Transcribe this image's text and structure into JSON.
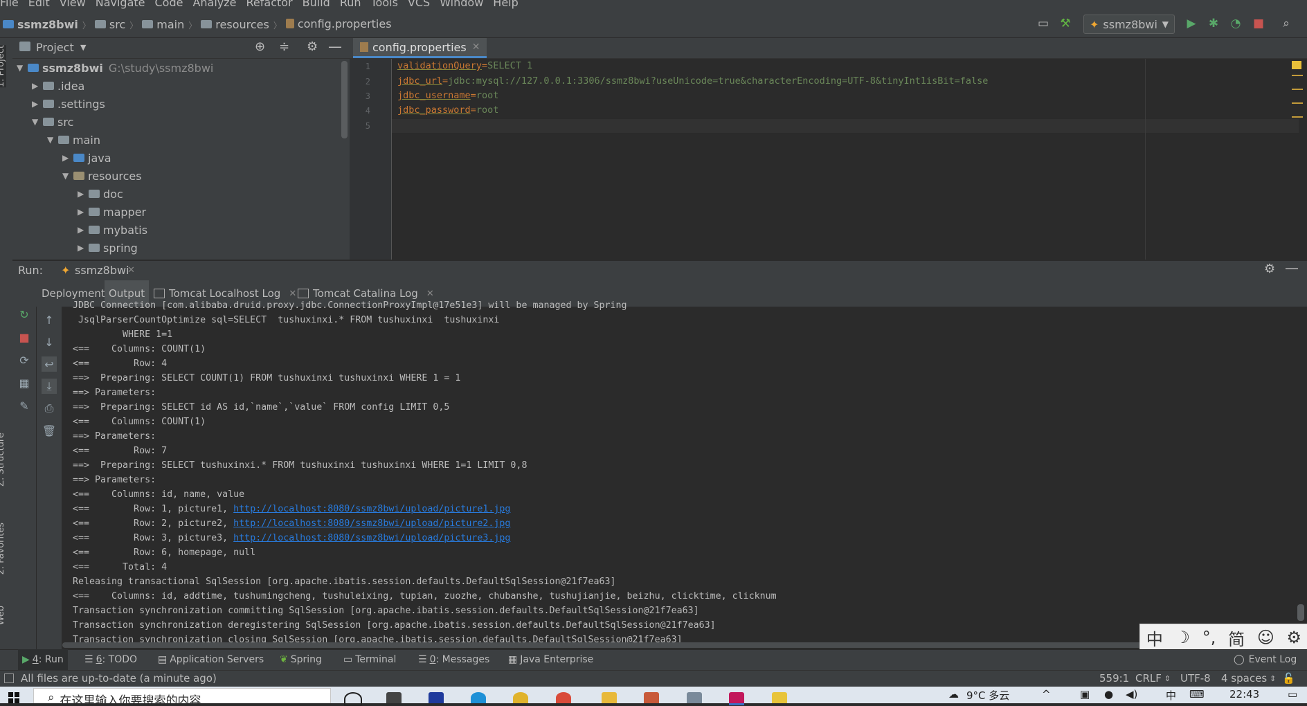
{
  "menu": [
    "File",
    "Edit",
    "View",
    "Navigate",
    "Code",
    "Analyze",
    "Refactor",
    "Build",
    "Run",
    "Tools",
    "VCS",
    "Window",
    "Help"
  ],
  "breadcrumbs": [
    "ssmz8bwi",
    "src",
    "main",
    "resources",
    "config.properties"
  ],
  "run_config": "ssmz8bwi",
  "side_labels": {
    "project": "1: Project",
    "structure": "Z: Structure",
    "favorites": "2: Favorites",
    "web": "Web"
  },
  "project_panel": {
    "title": "Project",
    "tree": [
      {
        "name": "ssmz8bwi",
        "path": "G:\\study\\ssmz8bwi",
        "depth": 0,
        "expanded": true
      },
      {
        "name": ".idea",
        "depth": 1,
        "expanded": false
      },
      {
        "name": ".settings",
        "depth": 1,
        "expanded": false
      },
      {
        "name": "src",
        "depth": 1,
        "expanded": true
      },
      {
        "name": "main",
        "depth": 2,
        "expanded": true
      },
      {
        "name": "java",
        "depth": 3,
        "expanded": false
      },
      {
        "name": "resources",
        "depth": 3,
        "expanded": true
      },
      {
        "name": "doc",
        "depth": 4,
        "expanded": false
      },
      {
        "name": "mapper",
        "depth": 4,
        "expanded": false
      },
      {
        "name": "mybatis",
        "depth": 4,
        "expanded": false
      },
      {
        "name": "spring",
        "depth": 4,
        "expanded": false
      }
    ]
  },
  "editor": {
    "tab": "config.properties",
    "lines": [
      {
        "num": "1",
        "key": "validationQuery",
        "value": "SELECT 1"
      },
      {
        "num": "2",
        "key": "jdbc_url",
        "value": "jdbc:mysql://127.0.0.1:3306/ssmz8bwi?useUnicode=true&characterEncoding=UTF-8&tinyInt1isBit=false"
      },
      {
        "num": "3",
        "key": "jdbc_username",
        "value": "root"
      },
      {
        "num": "4",
        "key": "jdbc_password",
        "value": "root"
      },
      {
        "num": "5",
        "key": "",
        "value": ""
      }
    ]
  },
  "run_panel": {
    "label": "Run:",
    "config": "ssmz8bwi",
    "tabs": [
      "Deployment",
      "Output",
      "Tomcat Localhost Log",
      "Tomcat Catalina Log"
    ],
    "console": [
      {
        "text": "JDBC Connection [com.alibaba.druid.proxy.jdbc.ConnectionProxyImpl@17e51e3] will be managed by Spring"
      },
      {
        "text": " JsqlParserCountOptimize sql=SELECT  tushuxinxi.* FROM tushuxinxi  tushuxinxi"
      },
      {
        "text": "         WHERE 1=1"
      },
      {
        "text": "<==    Columns: COUNT(1)"
      },
      {
        "text": "<==        Row: 4"
      },
      {
        "text": "==>  Preparing: SELECT COUNT(1) FROM tushuxinxi tushuxinxi WHERE 1 = 1"
      },
      {
        "text": "==> Parameters: "
      },
      {
        "text": "==>  Preparing: SELECT id AS id,`name`,`value` FROM config LIMIT 0,5"
      },
      {
        "text": "<==    Columns: COUNT(1)"
      },
      {
        "text": "==> Parameters: "
      },
      {
        "text": "<==        Row: 7"
      },
      {
        "text": "==>  Preparing: SELECT tushuxinxi.* FROM tushuxinxi tushuxinxi WHERE 1=1 LIMIT 0,8"
      },
      {
        "text": "==> Parameters: "
      },
      {
        "text": "<==    Columns: id, name, value"
      },
      {
        "text": "<==        Row: 1, picture1, ",
        "link": "http://localhost:8080/ssmz8bwi/upload/picture1.jpg"
      },
      {
        "text": "<==        Row: 2, picture2, ",
        "link": "http://localhost:8080/ssmz8bwi/upload/picture2.jpg"
      },
      {
        "text": "<==        Row: 3, picture3, ",
        "link": "http://localhost:8080/ssmz8bwi/upload/picture3.jpg"
      },
      {
        "text": "<==        Row: 6, homepage, null"
      },
      {
        "text": "<==      Total: 4"
      },
      {
        "text": "Releasing transactional SqlSession [org.apache.ibatis.session.defaults.DefaultSqlSession@21f7ea63]"
      },
      {
        "text": "<==    Columns: id, addtime, tushumingcheng, tushuleixing, tupian, zuozhe, chubanshe, tushujianjie, beizhu, clicktime, clicknum"
      },
      {
        "text": "Transaction synchronization committing SqlSession [org.apache.ibatis.session.defaults.DefaultSqlSession@21f7ea63]"
      },
      {
        "text": "Transaction synchronization deregistering SqlSession [org.apache.ibatis.session.defaults.DefaultSqlSession@21f7ea63]"
      },
      {
        "text": "Transaction synchronization closing SqlSession [org.apache.ibatis.session.defaults.DefaultSqlSession@21f7ea63]"
      }
    ]
  },
  "ime": [
    "中",
    "☽",
    "°,",
    "简",
    "☺",
    "⚙"
  ],
  "bottom_tabs": [
    {
      "num": "4",
      "label": ": Run"
    },
    {
      "num": "6",
      "label": ": TODO"
    },
    {
      "num": "",
      "label": "Application Servers"
    },
    {
      "num": "",
      "label": "Spring"
    },
    {
      "num": "",
      "label": "Terminal"
    },
    {
      "num": "0",
      "label": ": Messages"
    },
    {
      "num": "",
      "label": "Java Enterprise"
    }
  ],
  "event_log": "Event Log",
  "status": {
    "message": "All files are up-to-date (a minute ago)",
    "position": "559:1",
    "line_sep": "CRLF",
    "encoding": "UTF-8",
    "indent": "4 spaces"
  },
  "taskbar": {
    "search_placeholder": "在这里输入你要搜索的内容",
    "weather": "9°C 多云",
    "time": "22:43"
  },
  "colors": {
    "accent": "#4a88c7",
    "keyword": "#cc7832",
    "string": "#6a8759",
    "link": "#287bde"
  }
}
